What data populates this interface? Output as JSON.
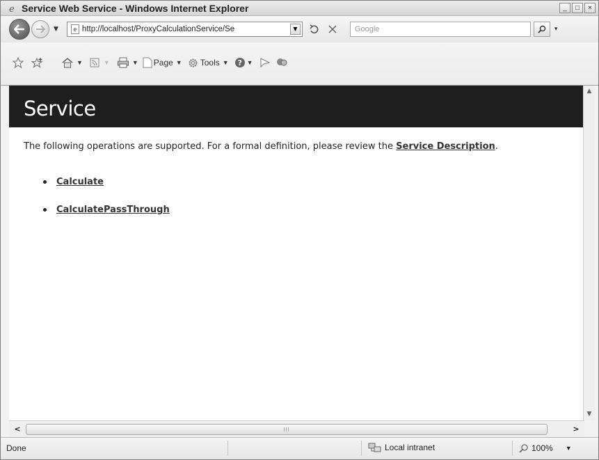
{
  "window": {
    "title": "Service Web Service - Windows Internet Explorer",
    "minimize_glyph": "_",
    "maximize_glyph": "□",
    "close_glyph": "×"
  },
  "address": {
    "url": "http://localhost/ProxyCalculationService/Se",
    "search_placeholder": "Google"
  },
  "command_bar": {
    "page_label": "Page",
    "tools_label": "Tools"
  },
  "page": {
    "heading": "Service",
    "intro_text": "The following operations are supported. For a formal definition, please review the ",
    "service_description_link": "Service Description",
    "intro_end": ".",
    "operations": [
      {
        "label": "Calculate"
      },
      {
        "label": "CalculatePassThrough"
      }
    ]
  },
  "status": {
    "text": "Done",
    "zone": "Local intranet",
    "zoom": "100%"
  },
  "icons": {
    "title": "ie-logo-icon",
    "back": "back-arrow-icon",
    "forward": "forward-arrow-icon",
    "refresh": "refresh-icon",
    "stop": "stop-icon",
    "search": "magnifier-icon",
    "favorites": "star-icon",
    "add_favorites": "add-favorites-icon",
    "home": "home-icon",
    "feeds": "feeds-icon",
    "print": "printer-icon",
    "help": "help-icon",
    "research": "research-icon",
    "messenger": "messenger-icon",
    "zone": "intranet-icon",
    "zoom": "zoom-magnifier-icon"
  },
  "colors": {
    "heading_bar": "#1e1e1e",
    "heading_text": "#ffffff",
    "link": "#333333"
  }
}
